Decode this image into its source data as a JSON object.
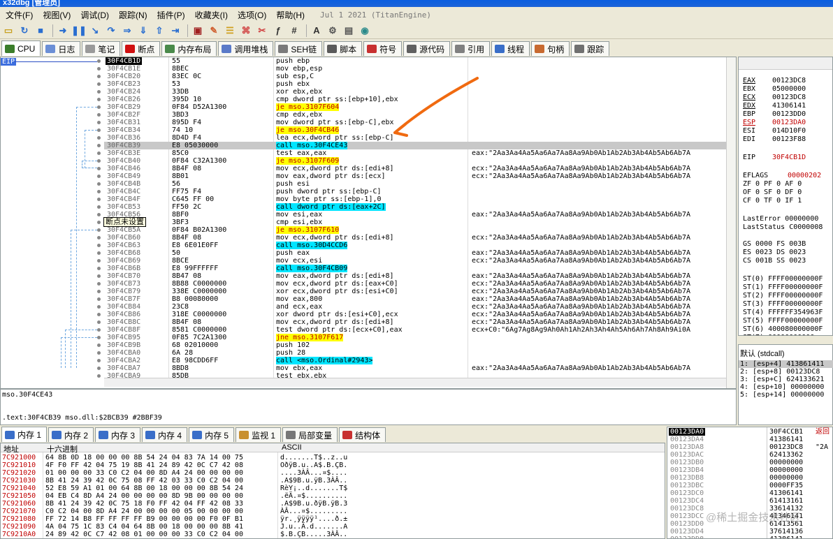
{
  "titlebar": {
    "text": "x32dbg [管理员]"
  },
  "menu": {
    "items": [
      "文件(F)",
      "视图(V)",
      "调试(D)",
      "跟踪(N)",
      "插件(P)",
      "收藏夹(I)",
      "选项(O)",
      "帮助(H)"
    ],
    "build_date": "Jul 1 2021 (TitanEngine)"
  },
  "toolbar": {
    "icons": [
      "open-icon",
      "restart-icon",
      "stop-icon",
      "run-icon",
      "pause-icon",
      "step-into-icon",
      "step-over-icon",
      "trace-into-icon",
      "trace-over-icon",
      "execute-till-return-icon",
      "run-to-user-code-icon",
      "scylla-icon",
      "patch-icon",
      "comment-icon",
      "label-icon",
      "bookmark-icon",
      "function-icon",
      "argument-icon",
      "font-icon",
      "settings-icon",
      "calculator-icon",
      "globe-icon"
    ],
    "fx_label": "fx",
    "hash_label": "#",
    "aa_label": "A₂"
  },
  "tabs": [
    {
      "label": "CPU",
      "icon": "cpu-icon",
      "color": "#3a7d2a"
    },
    {
      "label": "日志",
      "icon": "log-icon",
      "color": "#6b8fd6"
    },
    {
      "label": "笔记",
      "icon": "notes-icon",
      "color": "#9a9a9a"
    },
    {
      "label": "断点",
      "icon": "breakpoint-icon",
      "color": "#d01010"
    },
    {
      "label": "内存布局",
      "icon": "memory-map-icon",
      "color": "#4a8a4a"
    },
    {
      "label": "调用堆栈",
      "icon": "call-stack-icon",
      "color": "#5a7ac8"
    },
    {
      "label": "SEH链",
      "icon": "seh-icon",
      "color": "#7a7a7a"
    },
    {
      "label": "脚本",
      "icon": "script-icon",
      "color": "#5a5a5a"
    },
    {
      "label": "符号",
      "icon": "symbols-icon",
      "color": "#c83030"
    },
    {
      "label": "源代码",
      "icon": "source-icon",
      "color": "#606060"
    },
    {
      "label": "引用",
      "icon": "references-icon",
      "color": "#808080"
    },
    {
      "label": "线程",
      "icon": "threads-icon",
      "color": "#3a6ec8"
    },
    {
      "label": "句柄",
      "icon": "handles-icon",
      "color": "#c86a30"
    },
    {
      "label": "跟踪",
      "icon": "trace-icon",
      "color": "#707070"
    }
  ],
  "disasm": {
    "eip_label": "EIP",
    "tooltip": "断点未设置",
    "rows": [
      {
        "addr": "30F4CB1D",
        "bytes": "55",
        "instr": "push ebp",
        "cmt": "",
        "eip": true
      },
      {
        "addr": "30F4CB1E",
        "bytes": "8BEC",
        "instr": "mov ebp,esp",
        "cmt": ""
      },
      {
        "addr": "30F4CB20",
        "bytes": "83EC 0C",
        "instr": "sub esp,C",
        "cmt": ""
      },
      {
        "addr": "30F4CB23",
        "bytes": "53",
        "instr": "push ebx",
        "cmt": ""
      },
      {
        "addr": "30F4CB24",
        "bytes": "33DB",
        "instr": "xor ebx,ebx",
        "cmt": ""
      },
      {
        "addr": "30F4CB26",
        "bytes": "395D 10",
        "instr": "cmp dword ptr ss:[ebp+10],ebx",
        "cmt": ""
      },
      {
        "addr": "30F4CB29",
        "bytes": "0F84 D52A1300",
        "instr": "je mso.3107F604",
        "cmt": "",
        "kind": "jmp"
      },
      {
        "addr": "30F4CB2F",
        "bytes": "3BD3",
        "instr": "cmp edx,ebx",
        "cmt": ""
      },
      {
        "addr": "30F4CB31",
        "bytes": "895D F4",
        "instr": "mov dword ptr ss:[ebp-C],ebx",
        "cmt": ""
      },
      {
        "addr": "30F4CB34",
        "bytes": "74 10",
        "instr": "je mso.30F4CB46",
        "cmt": "",
        "kind": "jmp"
      },
      {
        "addr": "30F4CB36",
        "bytes": "8D4D F4",
        "instr": "lea ecx,dword ptr ss:[ebp-C]",
        "cmt": ""
      },
      {
        "addr": "30F4CB39",
        "bytes": "E8 05030000",
        "instr": "call mso.30F4CE43",
        "cmt": "",
        "kind": "call",
        "current": true
      },
      {
        "addr": "30F4CB3E",
        "bytes": "85C0",
        "instr": "test eax,eax",
        "cmt": "eax:\"2Aa3Aa4Aa5Aa6Aa7Aa8Aa9Ab0Ab1Ab2Ab3Ab4Ab5Ab6Ab7A"
      },
      {
        "addr": "30F4CB40",
        "bytes": "0F84 C32A1300",
        "instr": "je mso.3107F609",
        "cmt": "",
        "kind": "jmp"
      },
      {
        "addr": "30F4CB46",
        "bytes": "8B4F 08",
        "instr": "mov ecx,dword ptr ds:[edi+8]",
        "cmt": "ecx:\"2Aa3Aa4Aa5Aa6Aa7Aa8Aa9Ab0Ab1Ab2Ab3Ab4Ab5Ab6Ab7A"
      },
      {
        "addr": "30F4CB49",
        "bytes": "8B01",
        "instr": "mov eax,dword ptr ds:[ecx]",
        "cmt": "ecx:\"2Aa3Aa4Aa5Aa6Aa7Aa8Aa9Ab0Ab1Ab2Ab3Ab4Ab5Ab6Ab7A"
      },
      {
        "addr": "30F4CB4B",
        "bytes": "56",
        "instr": "push esi",
        "cmt": ""
      },
      {
        "addr": "30F4CB4C",
        "bytes": "FF75 F4",
        "instr": "push dword ptr ss:[ebp-C]",
        "cmt": ""
      },
      {
        "addr": "30F4CB4F",
        "bytes": "C645 FF 00",
        "instr": "mov byte ptr ss:[ebp-1],0",
        "cmt": ""
      },
      {
        "addr": "30F4CB53",
        "bytes": "FF50 2C",
        "instr": "call dword ptr ds:[eax+2C]",
        "cmt": "",
        "kind": "call"
      },
      {
        "addr": "30F4CB56",
        "bytes": "8BF0",
        "instr": "mov esi,eax",
        "cmt": "eax:\"2Aa3Aa4Aa5Aa6Aa7Aa8Aa9Ab0Ab1Ab2Ab3Ab4Ab5Ab6Ab7A"
      },
      {
        "addr": "30F4CB58",
        "bytes": "3BF3",
        "instr": "cmp esi,ebx",
        "cmt": ""
      },
      {
        "addr": "30F4CB5A",
        "bytes": "0F84 B02A1300",
        "instr": "je mso.3107F610",
        "cmt": "",
        "kind": "jmp"
      },
      {
        "addr": "30F4CB60",
        "bytes": "8B4F 08",
        "instr": "mov ecx,dword ptr ds:[edi+8]",
        "cmt": "ecx:\"2Aa3Aa4Aa5Aa6Aa7Aa8Aa9Ab0Ab1Ab2Ab3Ab4Ab5Ab6Ab7A"
      },
      {
        "addr": "30F4CB63",
        "bytes": "E8 6E01E0FF",
        "instr": "call mso.30D4CCD6",
        "cmt": "",
        "kind": "call"
      },
      {
        "addr": "30F4CB68",
        "bytes": "50",
        "instr": "push eax",
        "cmt": "eax:\"2Aa3Aa4Aa5Aa6Aa7Aa8Aa9Ab0Ab1Ab2Ab3Ab4Ab5Ab6Ab7A"
      },
      {
        "addr": "30F4CB69",
        "bytes": "8BCE",
        "instr": "mov ecx,esi",
        "cmt": "ecx:\"2Aa3Aa4Aa5Aa6Aa7Aa8Aa9Ab0Ab1Ab2Ab3Ab4Ab5Ab6Ab7A"
      },
      {
        "addr": "30F4CB6B",
        "bytes": "E8 99FFFFFF",
        "instr": "call mso.30F4CB09",
        "cmt": "",
        "kind": "call"
      },
      {
        "addr": "30F4CB70",
        "bytes": "8B47 08",
        "instr": "mov eax,dword ptr ds:[edi+8]",
        "cmt": "eax:\"2Aa3Aa4Aa5Aa6Aa7Aa8Aa9Ab0Ab1Ab2Ab3Ab4Ab5Ab6Ab7A"
      },
      {
        "addr": "30F4CB73",
        "bytes": "8B88 C0000000",
        "instr": "mov ecx,dword ptr ds:[eax+C0]",
        "cmt": "ecx:\"2Aa3Aa4Aa5Aa6Aa7Aa8Aa9Ab0Ab1Ab2Ab3Ab4Ab5Ab6Ab7A"
      },
      {
        "addr": "30F4CB79",
        "bytes": "338E C0000000",
        "instr": "xor ecx,dword ptr ds:[esi+C0]",
        "cmt": "ecx:\"2Aa3Aa4Aa5Aa6Aa7Aa8Aa9Ab0Ab1Ab2Ab3Ab4Ab5Ab6Ab7A"
      },
      {
        "addr": "30F4CB7F",
        "bytes": "B8 00080000",
        "instr": "mov eax,800",
        "cmt": "eax:\"2Aa3Aa4Aa5Aa6Aa7Aa8Aa9Ab0Ab1Ab2Ab3Ab4Ab5Ab6Ab7A"
      },
      {
        "addr": "30F4CB84",
        "bytes": "23C8",
        "instr": "and ecx,eax",
        "cmt": "ecx:\"2Aa3Aa4Aa5Aa6Aa7Aa8Aa9Ab0Ab1Ab2Ab3Ab4Ab5Ab6Ab7A"
      },
      {
        "addr": "30F4CB86",
        "bytes": "318E C0000000",
        "instr": "xor dword ptr ds:[esi+C0],ecx",
        "cmt": "ecx:\"2Aa3Aa4Aa5Aa6Aa7Aa8Aa9Ab0Ab1Ab2Ab3Ab4Ab5Ab6Ab7A"
      },
      {
        "addr": "30F4CB8C",
        "bytes": "8B4F 08",
        "instr": "mov ecx,dword ptr ds:[edi+8]",
        "cmt": "ecx:\"2Aa3Aa4Aa5Aa6Aa7Aa8Aa9Ab0Ab1Ab2Ab3Ab4Ab5Ab6Ab7A"
      },
      {
        "addr": "30F4CB8F",
        "bytes": "8581 C0000000",
        "instr": "test dword ptr ds:[ecx+C0],eax",
        "cmt": "ecx+C0:\"6Ag7Ag8Ag9Ah0Ah1Ah2Ah3Ah4Ah5Ah6Ah7Ah8Ah9Ai0A"
      },
      {
        "addr": "30F4CB95",
        "bytes": "0F85 7C2A1300",
        "instr": "jne mso.3107F617",
        "cmt": "",
        "kind": "jmp"
      },
      {
        "addr": "30F4CB9B",
        "bytes": "68 02010000",
        "instr": "push 102",
        "cmt": ""
      },
      {
        "addr": "30F4CBA0",
        "bytes": "6A 28",
        "instr": "push 28",
        "cmt": ""
      },
      {
        "addr": "30F4CBA2",
        "bytes": "E8 98CDD6FF",
        "instr": "call <mso.Ordinal#2943>",
        "cmt": "",
        "kind": "call"
      },
      {
        "addr": "30F4CBA7",
        "bytes": "8BD8",
        "instr": "mov ebx,eax",
        "cmt": "eax:\"2Aa3Aa4Aa5Aa6Aa7Aa8Aa9Ab0Ab1Ab2Ab3Ab4Ab5Ab6Ab7A"
      },
      {
        "addr": "30F4CBA9",
        "bytes": "85DB",
        "instr": "test ebx,ebx",
        "cmt": ""
      }
    ]
  },
  "info": {
    "line1": "mso.30F4CE43",
    "line2": ".text:30F4CB39 mso.dll:$2BCB39 #2BBF39"
  },
  "registers": {
    "gp": [
      {
        "name": "EAX",
        "value": "00123DC8",
        "underline": true
      },
      {
        "name": "EBX",
        "value": "05000000"
      },
      {
        "name": "ECX",
        "value": "00123DC8",
        "underline": true
      },
      {
        "name": "EDX",
        "value": "41306141",
        "underline": true
      },
      {
        "name": "EBP",
        "value": "00123DD0"
      },
      {
        "name": "ESP",
        "value": "00123DA0",
        "changed": true,
        "underline": true
      },
      {
        "name": "ESI",
        "value": "014D10F0"
      },
      {
        "name": "EDI",
        "value": "00123F88"
      }
    ],
    "eip": {
      "name": "EIP",
      "value": "30F4CB1D"
    },
    "eflags": {
      "name": "EFLAGS",
      "value": "00000202"
    },
    "flags": [
      "ZF 0  PF 0  AF 0",
      "OF 0  SF 0  DF 0",
      "CF 0  TF 0  IF 1"
    ],
    "last_error": "LastError  00000000",
    "last_status": "LastStatus C0000008",
    "segments": [
      "GS 0000  FS 003B",
      "ES 0023  DS 0023",
      "CS 001B  SS 0023"
    ],
    "fpu": [
      "ST(0) FFFF00000000F",
      "ST(1) FFFF00000000F",
      "ST(2) FFFF00000000F",
      "ST(3) FFFF00000000F",
      "ST(4) FFFFFF354963F",
      "ST(5) FFFF00000000F",
      "ST(6) 400080000000F",
      "ST(7) 00000000000"
    ]
  },
  "callconv": {
    "title": "默认 (stdcall)",
    "rows": [
      "1: [esp+4]  413861411",
      "2: [esp+8]  00123DC8",
      "3: [esp+C]  624133621",
      "4: [esp+10] 00000000",
      "5: [esp+14] 00000000"
    ]
  },
  "memtabs": [
    {
      "label": "内存 1",
      "icon": "memory-icon"
    },
    {
      "label": "内存 2",
      "icon": "memory-icon"
    },
    {
      "label": "内存 3",
      "icon": "memory-icon"
    },
    {
      "label": "内存 4",
      "icon": "memory-icon"
    },
    {
      "label": "内存 5",
      "icon": "memory-icon"
    },
    {
      "label": "监视 1",
      "icon": "watch-icon"
    },
    {
      "label": "局部变量",
      "icon": "locals-icon",
      "prefix": "[x=]"
    },
    {
      "label": "结构体",
      "icon": "struct-icon"
    }
  ],
  "dump": {
    "col_addr": "地址",
    "col_hex": "十六进制",
    "col_ascii": "ASCII",
    "rows": [
      {
        "addr": "7C921000",
        "hex": "64 8B 0D 18 00 00 00 8B 54 24 04 83 7A 14 00 75",
        "ascii": "d.......T$..z..u"
      },
      {
        "addr": "7C921010",
        "hex": "4F F0 FF 42 04 75 19 8B 41 24 89 42 0C C7 42 08",
        "ascii": "OðÿB.u..A$.B.ÇB."
      },
      {
        "addr": "7C921020",
        "hex": "01 00 00 00 33 C0 C2 04 00 8D A4 24 00 00 00 00",
        "ascii": "....3ÀÂ...¤$...."
      },
      {
        "addr": "7C921030",
        "hex": "8B 41 24 39 42 0C 75 08 FF 42 03 33 C0 C2 04 00",
        "ascii": ".A$9B.u.ÿB.3ÀÂ.."
      },
      {
        "addr": "7C921040",
        "hex": "52 E8 59 A1 01 00 64 8B 00 18 00 00 00 8B 54 24",
        "ascii": "RèY¡..d.......T$"
      },
      {
        "addr": "7C921050",
        "hex": "04 EB C4 8D A4 24 00 00 00 00 8D 9B 00 00 00 00",
        "ascii": ".ëÄ.¤$.........."
      },
      {
        "addr": "7C921060",
        "hex": "8B 41 24 39 42 0C 75 18 F0 FF 42 04 FF 42 08 33",
        "ascii": ".A$9B.u.ðÿB.ÿB.3"
      },
      {
        "addr": "7C921070",
        "hex": "C0 C2 04 00 8D A4 24 00 00 00 00 05 00 00 00 00",
        "ascii": "ÀÂ...¤$........."
      },
      {
        "addr": "7C921080",
        "hex": "FF 72 14 B8 FF FF FF FF B9 00 00 00 00 F0 0F B1",
        "ascii": "ÿr.¸ÿÿÿÿ¹....ð.±"
      },
      {
        "addr": "7C921090",
        "hex": "4A 04 75 1C 83 C4 04 64 8B 00 18 00 00 00 8B 41",
        "ascii": "J.u..Ä.d.......A"
      },
      {
        "addr": "7C9210A0",
        "hex": "24 89 42 0C C7 42 08 01 00 00 00 33 C0 C2 04 00",
        "ascii": "$.B.ÇB.....3ÀÂ.."
      }
    ]
  },
  "stack": {
    "rows": [
      {
        "addr": "00123DA0",
        "val": "30F4CCB1",
        "cmt": "返回",
        "top": true
      },
      {
        "addr": "00123DA4",
        "val": "41386141",
        "cmt": ""
      },
      {
        "addr": "00123DA8",
        "val": "00123DC8",
        "cmt": "\"2A"
      },
      {
        "addr": "00123DAC",
        "val": "62413362",
        "cmt": ""
      },
      {
        "addr": "00123DB0",
        "val": "00000000",
        "cmt": ""
      },
      {
        "addr": "00123DB4",
        "val": "00000000",
        "cmt": ""
      },
      {
        "addr": "00123DB8",
        "val": "00000000",
        "cmt": ""
      },
      {
        "addr": "00123DBC",
        "val": "0000FF35",
        "cmt": ""
      },
      {
        "addr": "00123DC0",
        "val": "41306141",
        "cmt": ""
      },
      {
        "addr": "00123DC4",
        "val": "61413161",
        "cmt": ""
      },
      {
        "addr": "00123DC8",
        "val": "33614132",
        "cmt": ""
      },
      {
        "addr": "00123DCC",
        "val": "41346141",
        "cmt": ""
      },
      {
        "addr": "00123DD0",
        "val": "61413561",
        "cmt": ""
      },
      {
        "addr": "00123DD4",
        "val": "37614136",
        "cmt": ""
      },
      {
        "addr": "00123DD8",
        "val": "41386141",
        "cmt": ""
      }
    ]
  },
  "watermark": "@稀土掘金技术社区"
}
